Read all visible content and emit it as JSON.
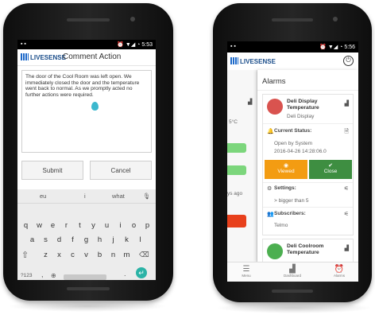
{
  "left_phone": {
    "statusbar": {
      "left_icons": "▪ ▪",
      "time": "5:53",
      "right_icons": "⏰ ▼◢ ◔"
    },
    "appbar": {
      "logo_text": "LIVESENSE",
      "title": "Comment Action"
    },
    "comment_text": "The door of the Cool Room was left open. We immediately closed the door and the temperature went back to normal. As we promptly acted no further actions were required.",
    "buttons": {
      "submit": "Submit",
      "cancel": "Cancel"
    },
    "keyboard": {
      "suggestions": [
        "eu",
        "i",
        "what"
      ],
      "row1": [
        "q",
        "w",
        "e",
        "r",
        "t",
        "y",
        "u",
        "i",
        "o",
        "p"
      ],
      "row2": [
        "a",
        "s",
        "d",
        "f",
        "g",
        "h",
        "j",
        "k",
        "l"
      ],
      "row3": [
        "z",
        "x",
        "c",
        "v",
        "b",
        "n",
        "m"
      ],
      "symbols_key": "?123",
      "comma": ",",
      "period": "."
    }
  },
  "right_phone": {
    "statusbar": {
      "left_icons": "▪ ▪",
      "time": "5:56",
      "right_icons": "⏰ ▼◢ ◔"
    },
    "appbar": {
      "logo_text": "LIVESENSE"
    },
    "peek": {
      "text1": "5°C",
      "text2": "ys ago"
    },
    "drawer": {
      "title": "Alarms",
      "alarm1": {
        "name": "Deli Display Temperature",
        "location": "Deli Display",
        "current_status_label": "Current Status:",
        "status_text": "Open by System",
        "status_time": "2016-04-26 14:28:06.0",
        "viewed_label": "Viewed",
        "close_label": "Close",
        "settings_label": "Settings:",
        "settings_value": "> bigger than 5",
        "subscribers_label": "Subscribers:",
        "subscribers_value": "Telmo"
      },
      "alarm2": {
        "name": "Deli Coolroom Temperature"
      }
    },
    "tabbar": {
      "menu": "Menu",
      "dashboard": "Dashboard",
      "alarms": "Alarms"
    }
  },
  "colors": {
    "brand_blue": "#1d69c9",
    "viewed_orange": "#f39c12",
    "close_green": "#3e8e41",
    "alarm_red": "#d9534f",
    "alarm_green": "#4caf50",
    "enter_teal": "#2bb3a6"
  }
}
